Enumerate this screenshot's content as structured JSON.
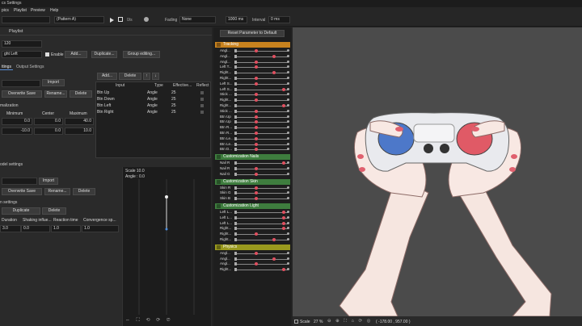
{
  "window": {
    "title": "cs Settings"
  },
  "menu": [
    "pics",
    "Playlist",
    "Preview",
    "Help"
  ],
  "toolbar": {
    "pattern": "(Pattern A)",
    "zoom_label": "0/s",
    "fading_label": "Fading",
    "fading_value": "None",
    "ms_value": "1000 ms",
    "interval_label": "Interval",
    "interval_value": "0 ms"
  },
  "playlist": {
    "title": "Playlist",
    "value": "120",
    "enable": "Enable",
    "add": "Add...",
    "duplicate": "Duplicate...",
    "group": "Group editing...",
    "target": "ght Left"
  },
  "tabs": [
    "ttings",
    "Output Settings"
  ],
  "settings": {
    "import": "Import",
    "overwrite": "Overwrite Save",
    "rename": "Rename...",
    "delete": "Delete",
    "normalization": "malization",
    "col_min": "Minimum",
    "col_center": "Center",
    "col_max": "Maximum",
    "min_val": "0.0",
    "center_val": "0.0",
    "max_val": "40.0",
    "min_val2": "-10.0",
    "center_val2": "0.0",
    "max_val2": "10.0"
  },
  "inputs_table": {
    "add": "Add...",
    "delete": "Delete",
    "up": "↑",
    "down": "↓",
    "columns": [
      "Input",
      "Type",
      "Effective...",
      "Reflect"
    ],
    "rows": [
      [
        "Btn Up",
        "Angle",
        "25"
      ],
      [
        "Btn Down",
        "Angle",
        "25"
      ],
      [
        "Btn Left",
        "Angle",
        "25"
      ],
      [
        "Btn Right",
        "Angle",
        "25"
      ]
    ]
  },
  "model_settings": {
    "title": "odel settings",
    "import": "Import",
    "overwrite": "Overwrite Save",
    "rename": "Rename...",
    "delete": "Delete",
    "sub": "n settings",
    "duplicate": "Duplicate",
    "delete2": "Delete",
    "cols": [
      "Duration",
      "Shaking influe...",
      "Reaction time",
      "Convergence sp..."
    ],
    "vals": [
      "3.0",
      "0.0",
      "1.0",
      "1.0"
    ]
  },
  "graph": {
    "scale": "Scale 10.0",
    "angle": "Angle : 0.0"
  },
  "params": {
    "reset": "Reset Parameter to Default",
    "categories": [
      {
        "name": "Tracking",
        "color": "#c8821e",
        "items": [
          "Angl...",
          "Angl...",
          "Angl...",
          "Left T...",
          "Right...",
          "Right...",
          "Left S...",
          "Left S...",
          "Stick ...",
          "Right...",
          "Right...",
          "Stick ...",
          "Btn Up",
          "Btn Up",
          "Btn R...",
          "Btn R...",
          "Btn Le...",
          "Btn Le...",
          "Btn D..."
        ]
      },
      {
        "name": "Customization Nails",
        "color": "#3e7d3e",
        "items": [
          "Nail R",
          "Nail R",
          "Nail G"
        ]
      },
      {
        "name": "Customization Skin",
        "color": "#3e7d3e",
        "items": [
          "Skin R",
          "Skin G",
          "Skin B"
        ]
      },
      {
        "name": "Customization Light",
        "color": "#3e7d3e",
        "items": [
          "Left L...",
          "Left L...",
          "Left L...",
          "Right...",
          "Right...",
          "Right..."
        ]
      },
      {
        "name": "Physics",
        "color": "#9a9a1e",
        "items": [
          "Angl...",
          "Angl...",
          "Angl...",
          "Right..."
        ]
      }
    ]
  },
  "status": {
    "scale": "Scale",
    "zoom": "27 %",
    "coords": "( -178.00 , 957.00 )"
  },
  "colors": {
    "bg": "#232323",
    "panel": "#2a2a2a",
    "preview": "#4b4b4b",
    "accent": "#e05060"
  }
}
